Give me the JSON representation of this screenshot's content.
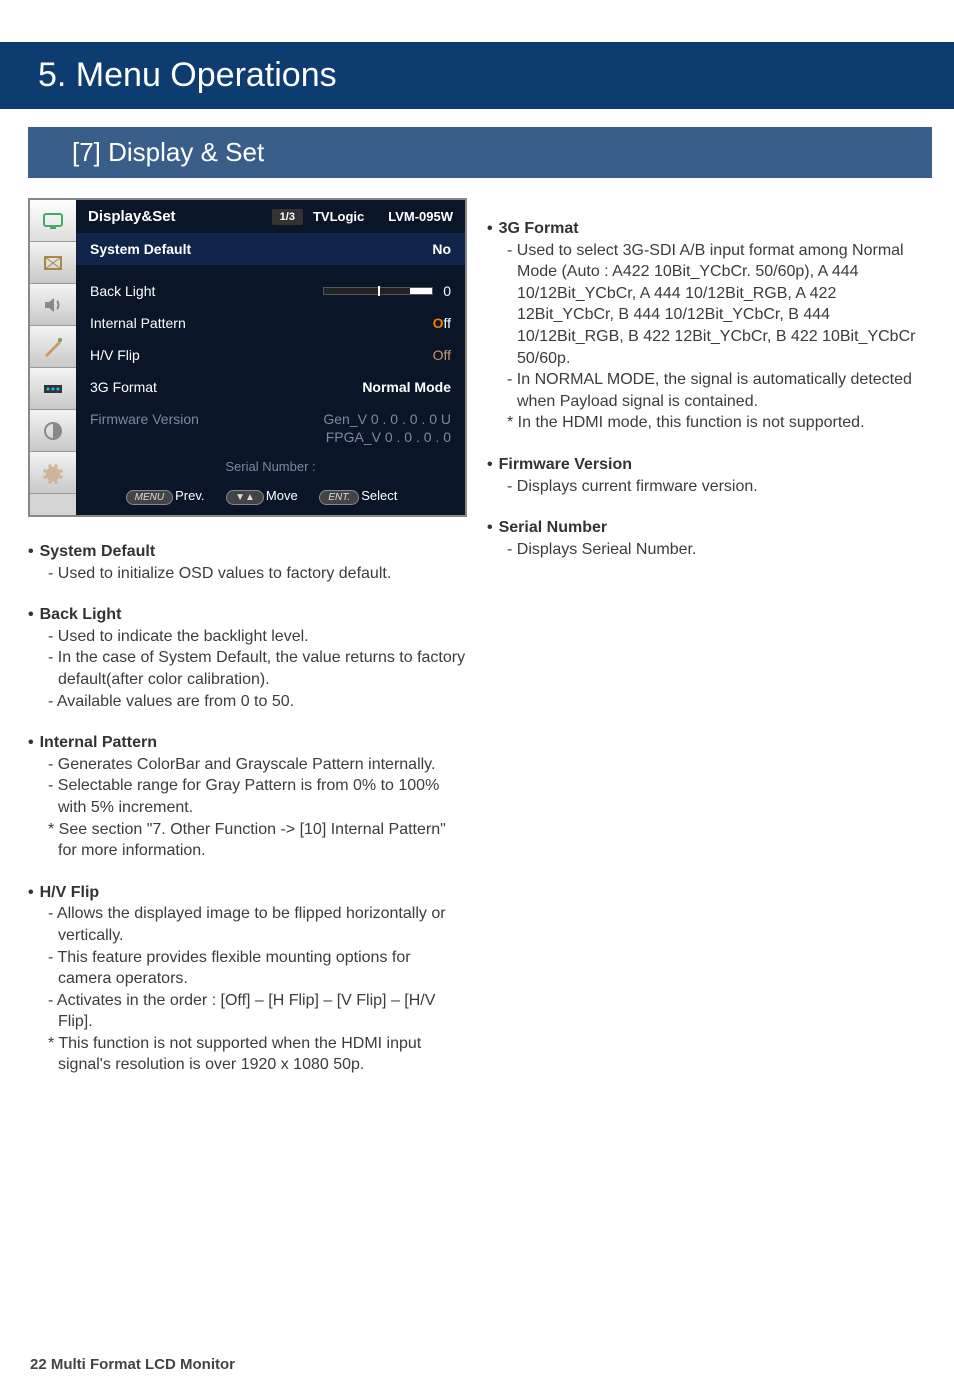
{
  "banner": "5. Menu Operations",
  "subbanner": "[7] Display & Set",
  "osd": {
    "title": "Display&Set",
    "page": "1/3",
    "brand": "TVLogic",
    "model": "LVM-095W",
    "rows": {
      "system_default": {
        "label": "System Default",
        "value": "No"
      },
      "back_light": {
        "label": "Back Light",
        "value": "0"
      },
      "internal_pattern": {
        "label": "Internal Pattern",
        "value_prefix": "O",
        "value_rest": "ff"
      },
      "hv_flip": {
        "label": "H/V Flip",
        "value": "Off"
      },
      "g3_format": {
        "label": "3G Format",
        "value": "Normal Mode"
      },
      "firmware": {
        "label": "Firmware Version",
        "value1": "Gen_V 0 . 0 . 0 . 0 U",
        "value2": "FPGA_V 0 . 0 . 0 . 0"
      }
    },
    "serial": "Serial Number :",
    "nav": {
      "prev_btn": "MENU",
      "prev_lbl": "Prev.",
      "move_btn": "▼▲",
      "move_lbl": "Move",
      "select_btn": "ENT.",
      "select_lbl": "Select"
    }
  },
  "left_sections": [
    {
      "head": "System Default",
      "lines": [
        "- Used to initialize OSD values to factory default."
      ]
    },
    {
      "head": "Back Light",
      "lines": [
        "- Used to indicate the backlight level.",
        "- In the case of System Default, the value returns to factory default(after color calibration).",
        "- Available values are from 0 to 50."
      ]
    },
    {
      "head": "Internal Pattern",
      "lines": [
        "- Generates ColorBar and Grayscale Pattern internally.",
        "- Selectable range for Gray Pattern is from 0% to 100% with 5% increment.",
        "* See section \"7. Other Function -> [10] Internal Pattern\" for more information."
      ]
    },
    {
      "head": "H/V Flip",
      "lines": [
        "- Allows the displayed image to be flipped horizontally or vertically.",
        "- This feature provides flexible mounting options for camera operators.",
        "- Activates in the order : [Off] – [H Flip] – [V Flip] – [H/V Flip].",
        "* This function is not supported when the HDMI input signal's resolution is over 1920 x 1080 50p."
      ]
    }
  ],
  "right_sections": [
    {
      "head": "3G Format",
      "lines": [
        "- Used to select 3G-SDI A/B input format among Normal Mode (Auto : A422 10Bit_YCbCr. 50/60p), A 444 10/12Bit_YCbCr, A 444 10/12Bit_RGB, A 422 12Bit_YCbCr, B 444 10/12Bit_YCbCr, B 444 10/12Bit_RGB, B 422 12Bit_YCbCr, B 422 10Bit_YCbCr 50/60p.",
        "- In NORMAL MODE, the signal is automatically detected when Payload signal is contained.",
        "* In the HDMI mode, this function is not supported."
      ]
    },
    {
      "head": "Firmware Version",
      "lines": [
        "- Displays current firmware version."
      ]
    },
    {
      "head": "Serial Number",
      "lines": [
        "- Displays Serieal Number."
      ]
    }
  ],
  "footer": "22 Multi Format LCD Monitor"
}
